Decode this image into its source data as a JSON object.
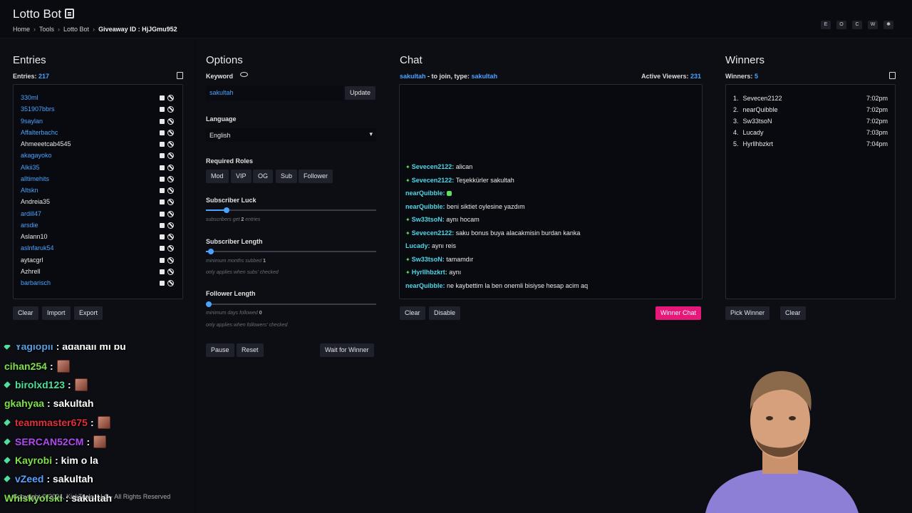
{
  "app": {
    "title": "Lotto Bot"
  },
  "breadcrumb": {
    "home": "Home",
    "tools": "Tools",
    "lotto": "Lotto Bot",
    "current": "Giveaway ID : HjJGmu952"
  },
  "top_buttons": [
    "E",
    "O",
    "C",
    "W",
    "✱"
  ],
  "entries": {
    "title": "Entries",
    "count_label": "Entries:",
    "count": "217",
    "items": [
      {
        "name": "330ml",
        "color": "#4aa3ff"
      },
      {
        "name": "351907bbrs",
        "color": "#4aa3ff"
      },
      {
        "name": "9saylan",
        "color": "#4aa3ff"
      },
      {
        "name": "Affalterbachc",
        "color": "#4aa3ff"
      },
      {
        "name": "Ahmeeetcab4545",
        "color": "#e8e8e8"
      },
      {
        "name": "akagayoko",
        "color": "#4aa3ff"
      },
      {
        "name": "Alkii35",
        "color": "#4aa3ff"
      },
      {
        "name": "alltimehits",
        "color": "#4aa3ff"
      },
      {
        "name": "Altskn",
        "color": "#4aa3ff"
      },
      {
        "name": "Andreia35",
        "color": "#e8e8e8"
      },
      {
        "name": "ardill47",
        "color": "#4aa3ff"
      },
      {
        "name": "arsdie",
        "color": "#4aa3ff"
      },
      {
        "name": "Aslann10",
        "color": "#e8e8e8"
      },
      {
        "name": "aslnfaruk54",
        "color": "#4aa3ff"
      },
      {
        "name": "aytacgrl",
        "color": "#e8e8e8"
      },
      {
        "name": "Azhrell",
        "color": "#e8e8e8"
      },
      {
        "name": "barbarisch",
        "color": "#4aa3ff"
      }
    ],
    "buttons": {
      "clear": "Clear",
      "import": "Import",
      "export": "Export"
    }
  },
  "options": {
    "title": "Options",
    "keyword_label": "Keyword",
    "keyword_value": "sakultah",
    "update": "Update",
    "language_label": "Language",
    "language_value": "English",
    "roles_label": "Required Roles",
    "roles": [
      "Mod",
      "VIP",
      "OG",
      "Sub",
      "Follower"
    ],
    "sub_luck_label": "Subscriber Luck",
    "sub_luck_hint_pre": "subscribers get",
    "sub_luck_hint_val": "2",
    "sub_luck_hint_post": "entries",
    "sub_luck_level": 0.12,
    "sub_length_label": "Subscriber Length",
    "sub_length_hint_pre": "minimum months subbed",
    "sub_length_hint_val": "1",
    "sub_length_note": "only applies when subs' checked",
    "sub_length_level": 0.03,
    "follower_label": "Follower Length",
    "follower_hint_pre": "minimum days followed",
    "follower_hint_val": "0",
    "follower_note": "only applies when followers' checked",
    "follower_level": 0.0,
    "pause": "Pause",
    "reset": "Reset",
    "wait": "Wait for Winner"
  },
  "chat": {
    "title": "Chat",
    "channel": "sakultah",
    "join_text": "- to join, type:",
    "keyword": "sakultah",
    "viewers_label": "Active Viewers:",
    "viewers": "231",
    "messages": [
      {
        "user": "Sevecen2122",
        "text": "alican",
        "gem": true,
        "color": "#4fd7e8"
      },
      {
        "user": "Sevecen2122",
        "text": "Teşekkürler sakultah",
        "gem": true,
        "color": "#4fd7e8"
      },
      {
        "user": "nearQuibble",
        "text": "",
        "gem": false,
        "color": "#4fd7e8",
        "emote": true
      },
      {
        "user": "nearQuibble",
        "text": "beni siktiet oylesine yazdım",
        "gem": false,
        "color": "#4fd7e8"
      },
      {
        "user": "Sw33tsoN",
        "text": "aynı hocam",
        "gem": true,
        "color": "#4fd7e8"
      },
      {
        "user": "Sevecen2122",
        "text": "saku bonus buya alacakmisin burdan kanka",
        "gem": true,
        "color": "#4fd7e8"
      },
      {
        "user": "Lucady",
        "text": "aynı reis",
        "gem": false,
        "color": "#4fd7e8"
      },
      {
        "user": "Sw33tsoN",
        "text": "tamamdır",
        "gem": true,
        "color": "#4fd7e8"
      },
      {
        "user": "Hyrllhbzkrt",
        "text": "aynı",
        "gem": true,
        "color": "#4fd7e8"
      },
      {
        "user": "nearQuibble",
        "text": "ne kaybettim la ben onemli bisiyse hesap acim aq",
        "gem": false,
        "color": "#4fd7e8"
      }
    ],
    "clear": "Clear",
    "disable": "Disable",
    "winner_chat": "Winner Chat"
  },
  "winners": {
    "title": "Winners",
    "count_label": "Winners:",
    "count": "5",
    "items": [
      {
        "rank": "1.",
        "name": "Sevecen2122",
        "time": "7:02pm"
      },
      {
        "rank": "2.",
        "name": "nearQuibble",
        "time": "7:02pm"
      },
      {
        "rank": "3.",
        "name": "Sw33tsoN",
        "time": "7:02pm"
      },
      {
        "rank": "4.",
        "name": "Lucady",
        "time": "7:03pm"
      },
      {
        "rank": "5.",
        "name": "Hyrllhbzkrt",
        "time": "7:04pm"
      }
    ],
    "pick": "Pick Winner",
    "clear": "Clear"
  },
  "overlay_chat": [
    {
      "user": "Yagiopli",
      "text": ": adanali mi bu",
      "color": "#5aa0e0",
      "gem": true,
      "emote": false
    },
    {
      "user": "cihan254",
      "text": ":",
      "color": "#7fe04a",
      "gem": false,
      "emote": true
    },
    {
      "user": "birolxd123",
      "text": ":",
      "color": "#4fe09a",
      "gem": true,
      "emote": true
    },
    {
      "user": "gkahyaa",
      "text": ": sakultah",
      "color": "#7fe04a",
      "gem": false,
      "emote": false
    },
    {
      "user": "teammaster675",
      "text": ":",
      "color": "#e0303a",
      "gem": true,
      "emote": true
    },
    {
      "user": "SERCAN52CM",
      "text": ":",
      "color": "#b04af0",
      "gem": true,
      "emote": true
    },
    {
      "user": "Kayrobi",
      "text": ": kim o la",
      "color": "#7fe04a",
      "gem": true,
      "emote": false
    },
    {
      "user": "vZeed",
      "text": ": sakultah",
      "color": "#5aa0ff",
      "gem": true,
      "emote": false
    },
    {
      "user": "Whiskyofski",
      "text": ": sakultah",
      "color": "#7fe04a",
      "gem": false,
      "emote": false
    }
  ],
  "footer": "Copyright © 2024, KickTools, LLC - All Rights Reserved"
}
